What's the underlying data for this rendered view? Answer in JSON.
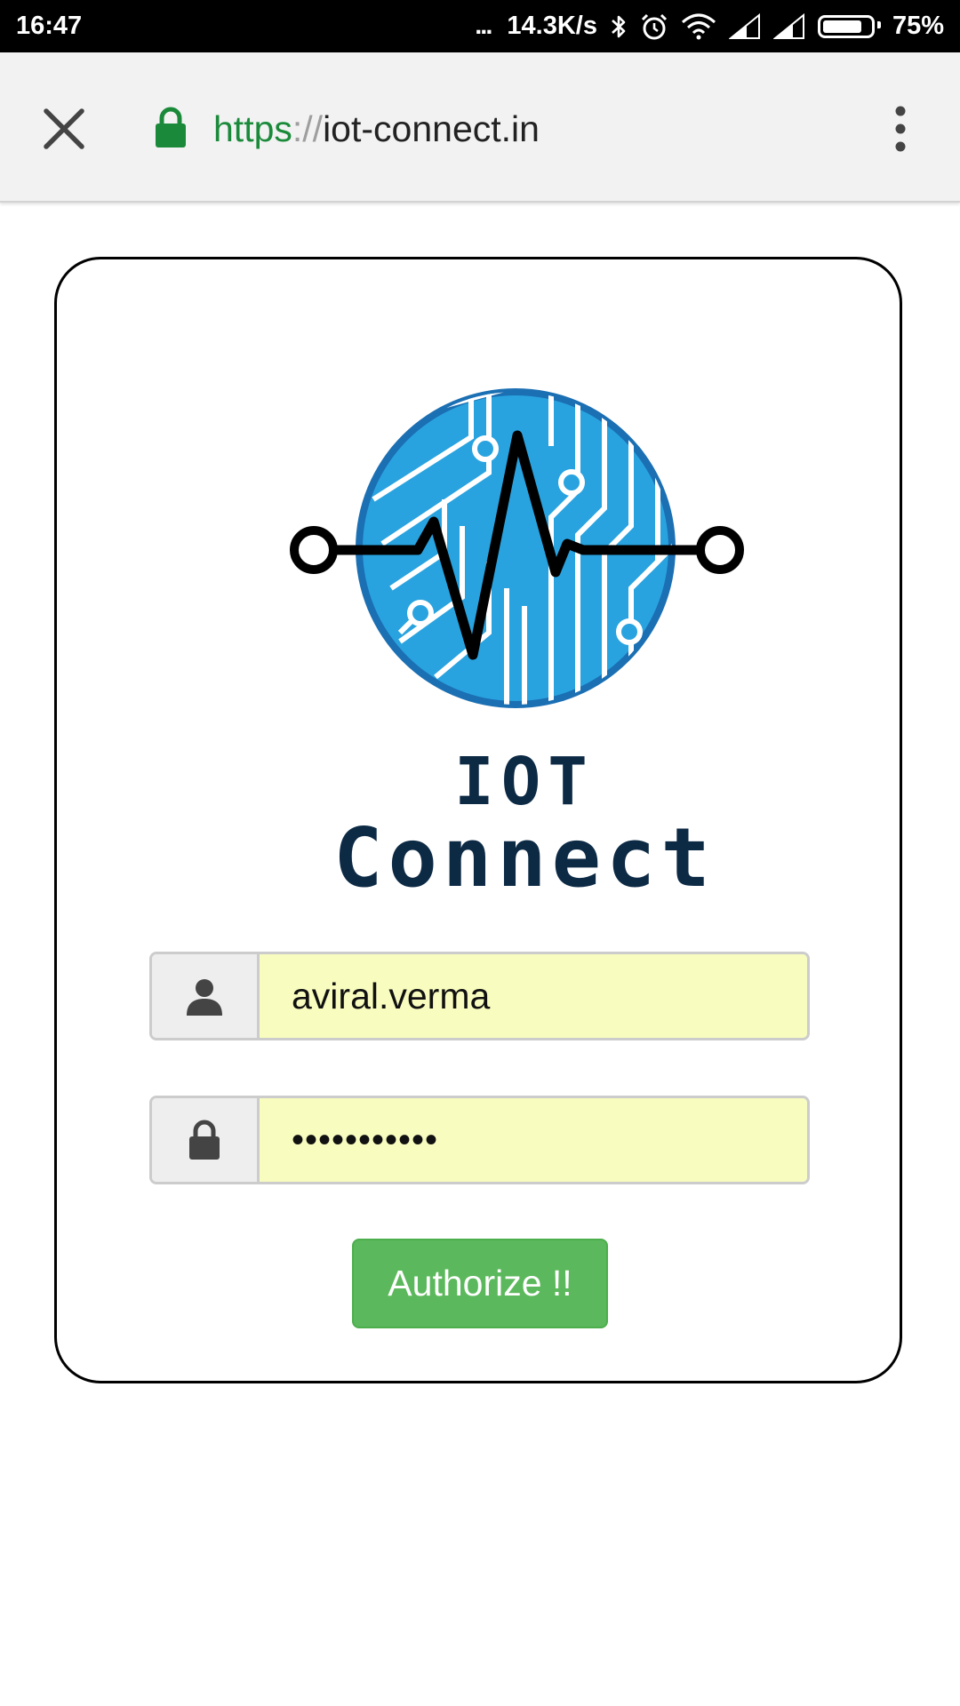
{
  "status_bar": {
    "time": "16:47",
    "overflow": "...",
    "net_speed": "14.3K/s",
    "battery": "75%",
    "icons": [
      "bluetooth-icon",
      "alarm-icon",
      "wifi-icon",
      "signal-icon",
      "signal-icon",
      "battery-icon"
    ]
  },
  "browser": {
    "url_scheme": "https",
    "url_separator": "://",
    "url_host": "iot-connect.in",
    "secure": true,
    "icons": {
      "close": "close-icon",
      "lock": "lock-icon",
      "menu": "more-vert-icon"
    },
    "secure_color": "#1a8a3a"
  },
  "brand": {
    "line1": "IOT",
    "line2": "Connect",
    "logo_colors": {
      "circle": "#29a3df",
      "ring": "#1b6fb3",
      "pulse": "#000000"
    }
  },
  "login": {
    "username": {
      "value": "aviral.verma",
      "icon": "user-icon"
    },
    "password": {
      "value": "•••••••••••",
      "icon": "lock-icon"
    },
    "submit_label": "Authorize !!",
    "button_color": "#5cb85c",
    "autofill_color": "#f8fcbe"
  }
}
